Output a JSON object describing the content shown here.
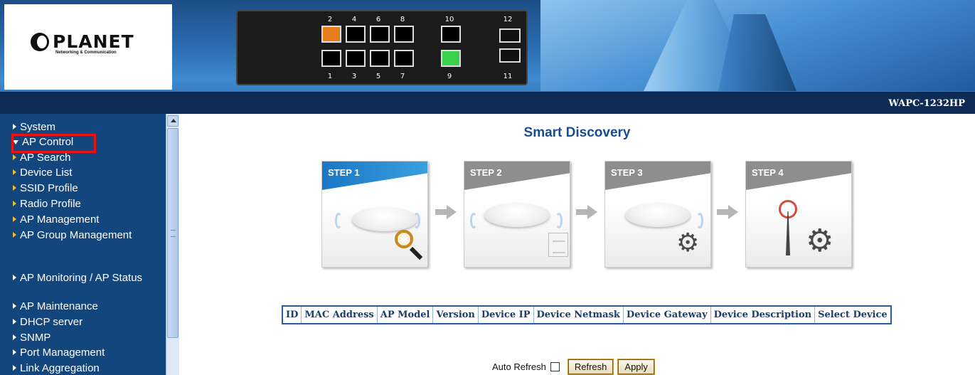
{
  "header": {
    "logo": {
      "brand": "PLANET",
      "tagline": "Networking & Communication"
    },
    "model": "WAPC-1232HP",
    "faceplate": {
      "top_port_numbers": [
        "2",
        "4",
        "6",
        "8",
        "10",
        "12"
      ],
      "bottom_port_numbers": [
        "1",
        "3",
        "5",
        "7",
        "9",
        "11"
      ],
      "active_ports": {
        "orange": "2",
        "green": "9"
      }
    }
  },
  "sidebar": {
    "items": [
      {
        "label": "System"
      },
      {
        "label": "AP Control",
        "expanded": true,
        "highlighted": true
      },
      {
        "label": "AP Search",
        "sub": true
      },
      {
        "label": "Device List",
        "sub": true
      },
      {
        "label": "SSID Profile",
        "sub": true
      },
      {
        "label": "Radio Profile",
        "sub": true
      },
      {
        "label": "AP Management",
        "sub": true
      },
      {
        "label": "AP Group Management",
        "sub": true
      },
      {
        "label": "AP Monitoring / AP Status"
      },
      {
        "label": "AP Maintenance"
      },
      {
        "label": "DHCP server"
      },
      {
        "label": "SNMP"
      },
      {
        "label": "Port Management"
      },
      {
        "label": "Link Aggregation"
      }
    ]
  },
  "main": {
    "title": "Smart Discovery",
    "steps": [
      "STEP 1",
      "STEP 2",
      "STEP 3",
      "STEP 4"
    ],
    "table": {
      "columns": [
        "ID",
        "MAC Address",
        "AP Model",
        "Version",
        "Device IP",
        "Device Netmask",
        "Device Gateway",
        "Device Description",
        "Select Device"
      ]
    },
    "controls": {
      "auto_refresh_label": "Auto Refresh",
      "auto_refresh_checked": false,
      "refresh_button": "Refresh",
      "apply_button": "Apply"
    }
  },
  "colors": {
    "header_dark": "#0d2b55",
    "sidebar_bg": "#14467e",
    "title_blue": "#1a4d8f",
    "highlight_red": "#ee1111",
    "port_orange": "#e37f1e",
    "port_green": "#3bd14a"
  }
}
